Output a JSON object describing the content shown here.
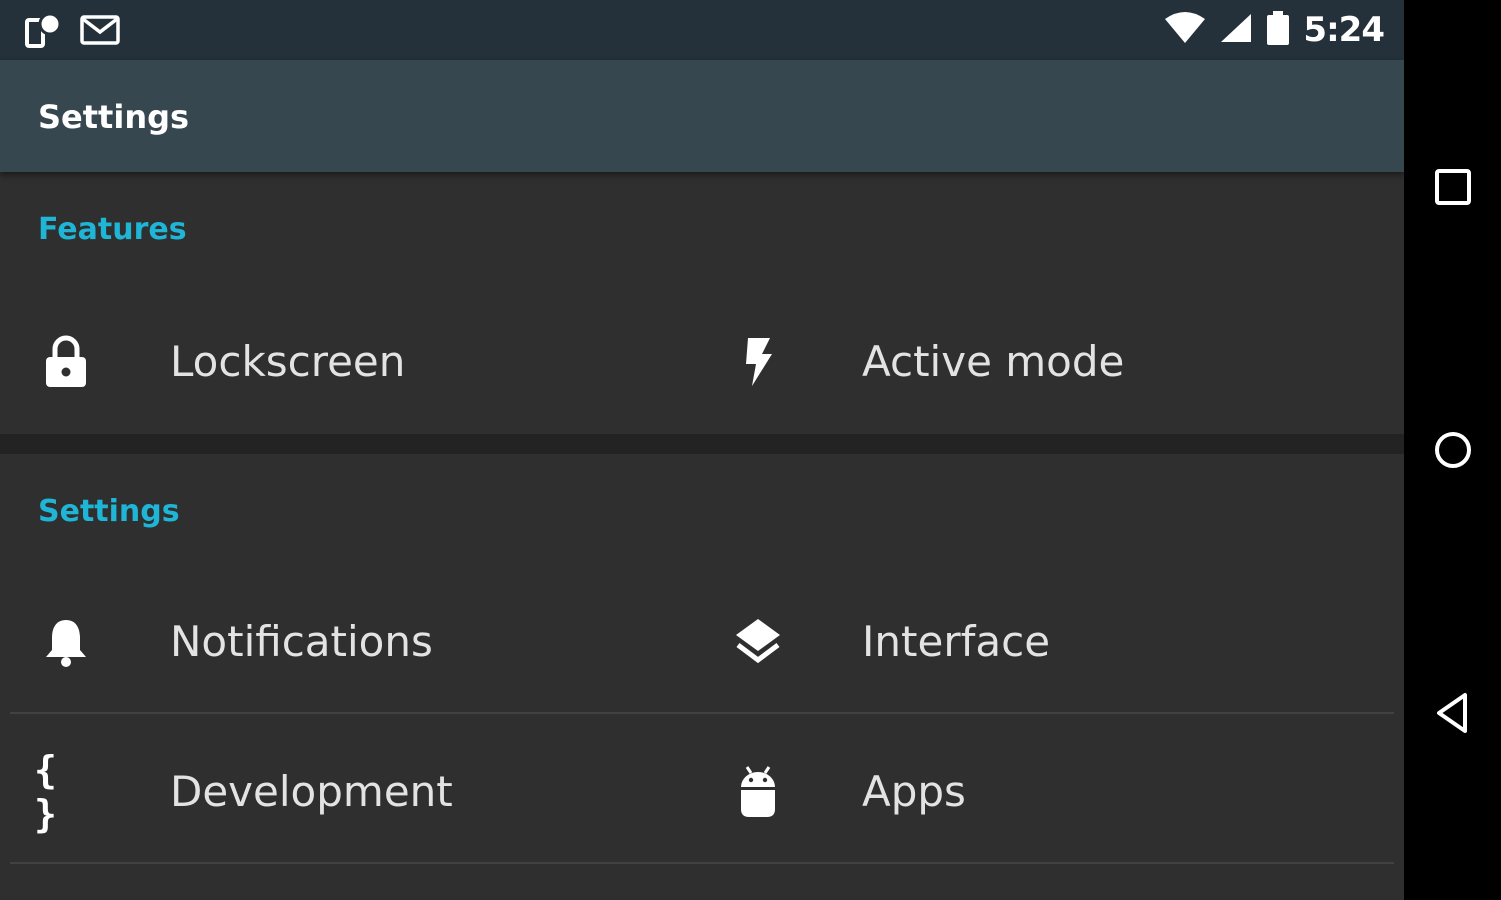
{
  "status_bar": {
    "time": "5:24",
    "left_icons": [
      "device-sync-icon",
      "mail-icon"
    ],
    "right_icons": [
      "wifi-icon",
      "cell-signal-icon",
      "battery-icon"
    ]
  },
  "app_bar": {
    "title": "Settings"
  },
  "sections": [
    {
      "header": "Features",
      "items": [
        {
          "label": "Lockscreen",
          "icon": "lock-icon"
        },
        {
          "label": "Active mode",
          "icon": "flash-icon"
        }
      ]
    },
    {
      "header": "Settings",
      "items": [
        {
          "label": "Notifications",
          "icon": "bell-icon"
        },
        {
          "label": "Interface",
          "icon": "layers-icon"
        },
        {
          "label": "Development",
          "icon": "braces-icon",
          "icon_text": "{ }"
        },
        {
          "label": "Apps",
          "icon": "android-icon"
        }
      ]
    }
  ],
  "nav_bar": {
    "buttons": [
      "recents-button",
      "home-button",
      "back-button"
    ]
  },
  "colors": {
    "accent": "#1fb5d6",
    "app_bar": "#37474f",
    "status_bar": "#25313a",
    "background": "#2f2f2f"
  }
}
